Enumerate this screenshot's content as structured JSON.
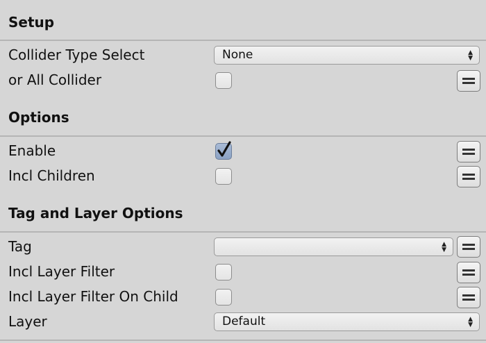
{
  "sections": {
    "setup": {
      "title": "Setup"
    },
    "options": {
      "title": "Options"
    },
    "tag_layer": {
      "title": "Tag and Layer Options"
    }
  },
  "fields": {
    "collider_type_select": {
      "label": "Collider Type Select",
      "value": "None"
    },
    "all_collider": {
      "label": "or All Collider",
      "checked": false
    },
    "enable": {
      "label": "Enable",
      "checked": true
    },
    "incl_children": {
      "label": "Incl Children",
      "checked": false
    },
    "tag": {
      "label": "Tag",
      "value": ""
    },
    "incl_layer_filter": {
      "label": "Incl Layer Filter",
      "checked": false
    },
    "incl_layer_filter_child": {
      "label": "Incl Layer Filter On Child",
      "checked": false
    },
    "layer": {
      "label": "Layer",
      "value": "Default"
    }
  },
  "icons": {
    "dropdown_arrow": "updown-arrows-icon",
    "menu_button": "equals-menu-icon",
    "check": "checkmark-icon"
  },
  "colors": {
    "background": "#d6d6d6",
    "divider": "#b5b5b5",
    "checked_fill": "#8ba2c4"
  }
}
